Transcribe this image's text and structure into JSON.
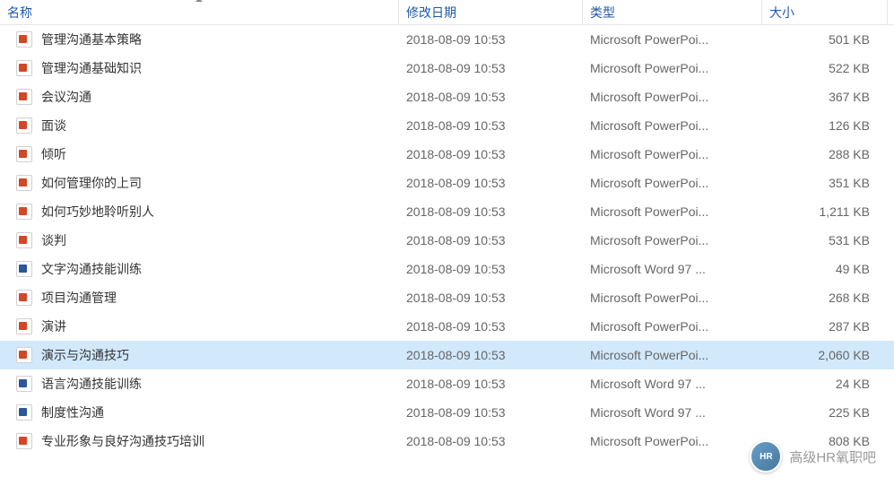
{
  "columns": {
    "name": "名称",
    "date": "修改日期",
    "type": "类型",
    "size": "大小"
  },
  "files": [
    {
      "name": "管理沟通基本策略",
      "date": "2018-08-09 10:53",
      "type": "Microsoft PowerPoi...",
      "size": "501 KB",
      "icon": "ppt",
      "selected": false
    },
    {
      "name": "管理沟通基础知识",
      "date": "2018-08-09 10:53",
      "type": "Microsoft PowerPoi...",
      "size": "522 KB",
      "icon": "ppt",
      "selected": false
    },
    {
      "name": "会议沟通",
      "date": "2018-08-09 10:53",
      "type": "Microsoft PowerPoi...",
      "size": "367 KB",
      "icon": "ppt",
      "selected": false
    },
    {
      "name": "面谈",
      "date": "2018-08-09 10:53",
      "type": "Microsoft PowerPoi...",
      "size": "126 KB",
      "icon": "ppt",
      "selected": false
    },
    {
      "name": "倾听",
      "date": "2018-08-09 10:53",
      "type": "Microsoft PowerPoi...",
      "size": "288 KB",
      "icon": "ppt",
      "selected": false
    },
    {
      "name": "如何管理你的上司",
      "date": "2018-08-09 10:53",
      "type": "Microsoft PowerPoi...",
      "size": "351 KB",
      "icon": "ppt",
      "selected": false
    },
    {
      "name": "如何巧妙地聆听别人",
      "date": "2018-08-09 10:53",
      "type": "Microsoft PowerPoi...",
      "size": "1,211 KB",
      "icon": "ppt",
      "selected": false
    },
    {
      "name": "谈判",
      "date": "2018-08-09 10:53",
      "type": "Microsoft PowerPoi...",
      "size": "531 KB",
      "icon": "ppt",
      "selected": false
    },
    {
      "name": "文字沟通技能训练",
      "date": "2018-08-09 10:53",
      "type": "Microsoft Word 97 ...",
      "size": "49 KB",
      "icon": "doc",
      "selected": false
    },
    {
      "name": "项目沟通管理",
      "date": "2018-08-09 10:53",
      "type": "Microsoft PowerPoi...",
      "size": "268 KB",
      "icon": "ppt",
      "selected": false
    },
    {
      "name": "演讲",
      "date": "2018-08-09 10:53",
      "type": "Microsoft PowerPoi...",
      "size": "287 KB",
      "icon": "ppt",
      "selected": false
    },
    {
      "name": "演示与沟通技巧",
      "date": "2018-08-09 10:53",
      "type": "Microsoft PowerPoi...",
      "size": "2,060 KB",
      "icon": "ppt",
      "selected": true
    },
    {
      "name": "语言沟通技能训练",
      "date": "2018-08-09 10:53",
      "type": "Microsoft Word 97 ...",
      "size": "24 KB",
      "icon": "doc",
      "selected": false
    },
    {
      "name": "制度性沟通",
      "date": "2018-08-09 10:53",
      "type": "Microsoft Word 97 ...",
      "size": "225 KB",
      "icon": "doc",
      "selected": false
    },
    {
      "name": "专业形象与良好沟通技巧培训",
      "date": "2018-08-09 10:53",
      "type": "Microsoft PowerPoi...",
      "size": "808 KB",
      "icon": "ppt",
      "selected": false
    }
  ],
  "watermark": {
    "text": "高级HR氧职吧",
    "avatar": "HR"
  }
}
